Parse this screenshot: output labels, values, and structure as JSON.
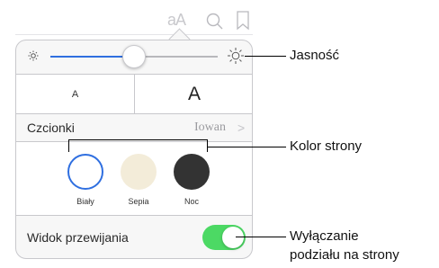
{
  "toolbar": {
    "font_button_label": "aA"
  },
  "brightness": {
    "level": 0.4
  },
  "font_size": {
    "small_label": "A",
    "large_label": "A"
  },
  "font": {
    "label": "Czcionki",
    "value": "Iowan",
    "chevron": ">"
  },
  "themes": [
    {
      "label": "Biały",
      "color": "#ffffff",
      "selected": true
    },
    {
      "label": "Sepia",
      "color": "#f3ecd9",
      "selected": false
    },
    {
      "label": "Noc",
      "color": "#333333",
      "selected": false
    }
  ],
  "scroll_view": {
    "label": "Widok przewijania",
    "on": true,
    "on_color": "#4cd964"
  },
  "callouts": {
    "brightness": "Jasność",
    "page_color": "Kolor strony",
    "scroll_line1": "Wyłączanie",
    "scroll_line2": "podziału na strony"
  },
  "colors": {
    "accent": "#2f6fe0",
    "selected_ring": "#2f6fe0"
  }
}
